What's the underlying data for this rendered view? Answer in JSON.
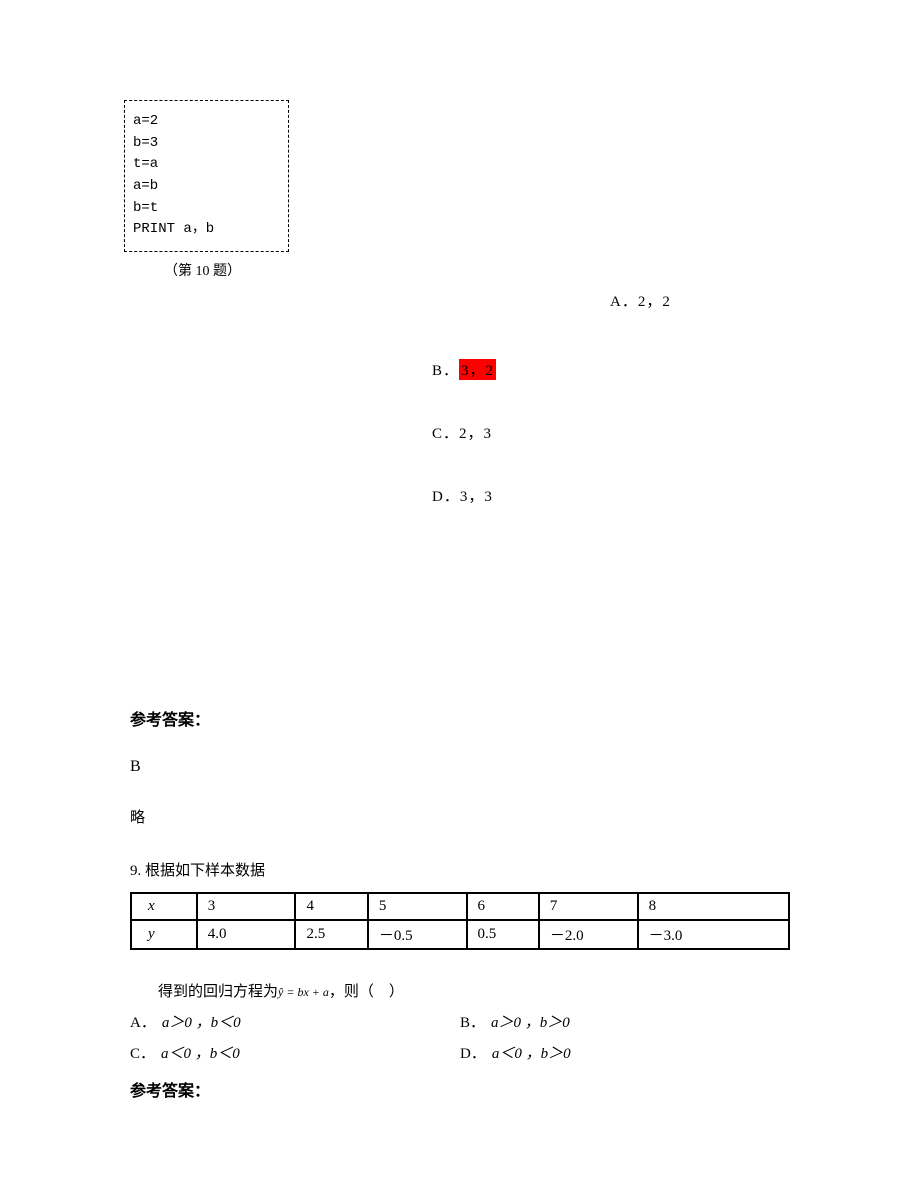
{
  "codebox": {
    "lines": [
      "a=2",
      "b=3",
      "t=a",
      "a=b",
      "b=t",
      "PRINT a，b"
    ],
    "caption": "（第 10 题）"
  },
  "q10_options": {
    "a": {
      "label": "A．",
      "value": "2，2"
    },
    "b": {
      "label": "B．",
      "value": "3，2"
    },
    "c": {
      "label": "C．",
      "value": "2，3"
    },
    "d": {
      "label": "D．",
      "value": "3，3"
    }
  },
  "answer_label": "参考答案：",
  "answer_value": "B",
  "answer_skip": "略",
  "q9": {
    "prompt": "9. 根据如下样本数据",
    "table": {
      "header_x": "x",
      "header_y": "y",
      "x": [
        "3",
        "4",
        "5",
        "6",
        "7",
        "8"
      ],
      "y": [
        "4.0",
        "2.5",
        "－0.5",
        "0.5",
        "－2.0",
        "－3.0"
      ]
    },
    "eq_prefix": "得到的回归方程为",
    "eq": "ŷ = bx + a",
    "eq_suffix": "，则（　）",
    "options": {
      "a": {
        "label": "A．",
        "cond": "a＞0 ，b＜0"
      },
      "b": {
        "label": "B．",
        "cond": "a＞0 ，b＞0"
      },
      "c": {
        "label": "C．",
        "cond": "a＜0 ，b＜0"
      },
      "d": {
        "label": "D．",
        "cond": "a＜0 ，b＞0"
      }
    }
  },
  "answer_label2": "参考答案："
}
